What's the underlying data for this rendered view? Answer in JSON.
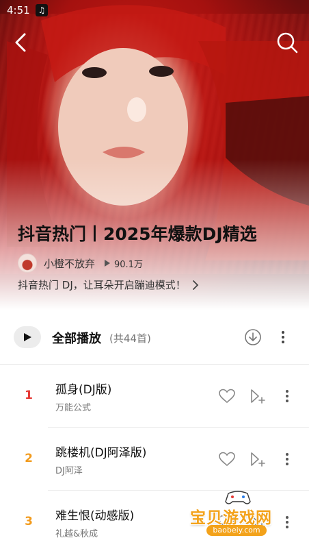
{
  "status_bar": {
    "time": "4:51",
    "music_icon": "music-note-icon"
  },
  "header": {
    "back_icon": "chevron-left-icon",
    "search_icon": "search-icon"
  },
  "playlist": {
    "title": "抖音热门丨2025年爆款DJ精选",
    "creator": "小橙不放弃",
    "play_count": "90.1万",
    "description": "抖音热门 DJ，让耳朵开启蹦迪模式！"
  },
  "play_all": {
    "label": "全部播放",
    "count": "(共44首)"
  },
  "songs": [
    {
      "index": "1",
      "title": "孤身(DJ版)",
      "artist": "万能公式",
      "index_color": "#e53935"
    },
    {
      "index": "2",
      "title": "跳楼机(DJ阿泽版)",
      "artist": "DJ阿泽",
      "index_color": "#f29b1d"
    },
    {
      "index": "3",
      "title": "难生恨(动感版)",
      "artist": "礼越&秋成",
      "index_color": "#f29b1d"
    }
  ],
  "watermark": {
    "text": "宝贝游戏网",
    "url": "baobeiy.com"
  },
  "colors": {
    "accent_red": "#e53935",
    "accent_orange": "#f29b1d",
    "watermark": "#f3a21a"
  }
}
